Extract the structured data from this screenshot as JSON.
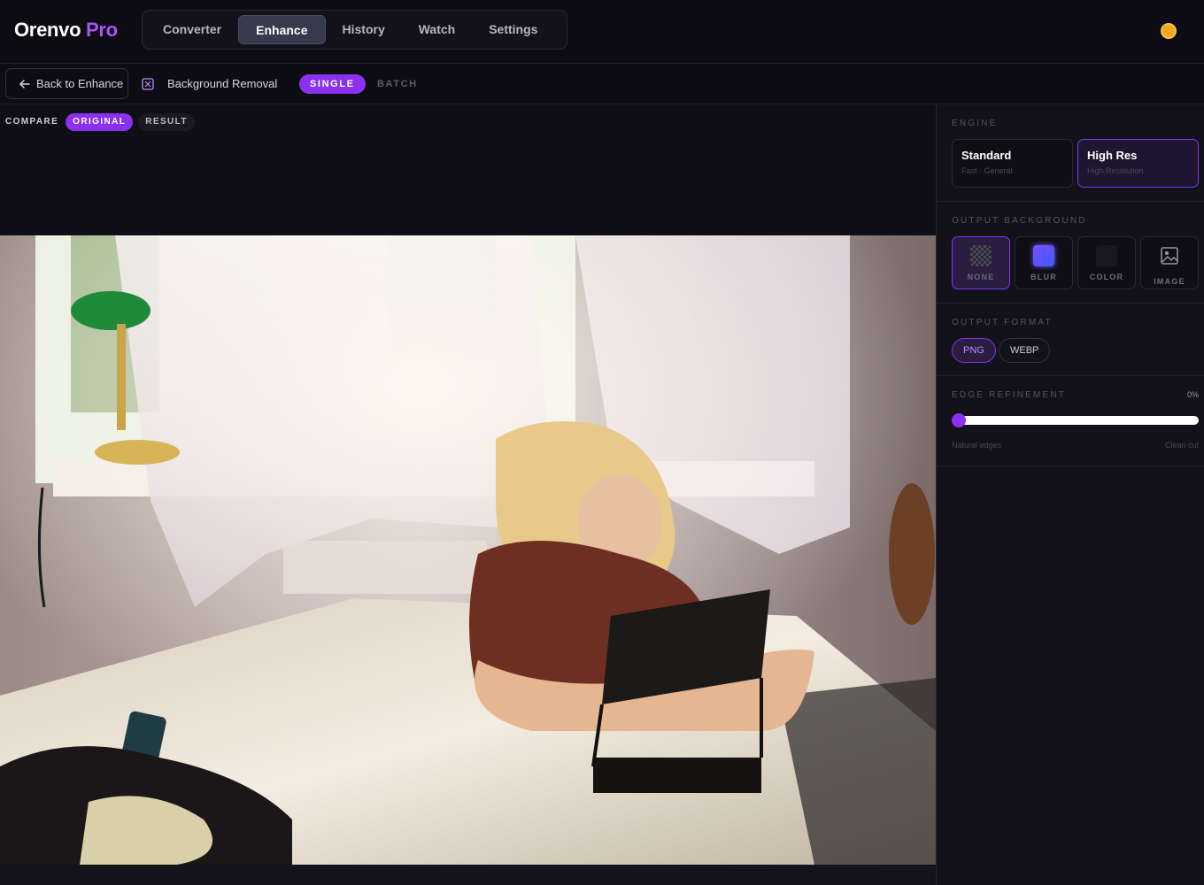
{
  "app": {
    "logo_main": "Orenvo",
    "logo_accent": "Pro",
    "accent_color": "#a855f7",
    "theme_icon": "sun-icon"
  },
  "nav": {
    "items": [
      {
        "label": "Converter"
      },
      {
        "label": "Enhance",
        "active": true
      },
      {
        "label": "History"
      },
      {
        "label": "Watch"
      },
      {
        "label": "Settings"
      }
    ]
  },
  "toolbar": {
    "back_label": "Back to Enhance",
    "back_icon": "arrow-left-icon",
    "tool_icon": "background-removal-icon",
    "tool_label": "Background Removal",
    "mode_single": "SINGLE",
    "mode_batch": "BATCH",
    "active_mode": "SINGLE"
  },
  "preview": {
    "tabs": [
      {
        "label": "COMPARE"
      },
      {
        "label": "ORIGINAL",
        "active": true
      },
      {
        "label": "RESULT"
      }
    ]
  },
  "sidebar": {
    "engine": {
      "title": "ENGINE",
      "options": [
        {
          "name": "Standard",
          "sub": "Fast · General"
        },
        {
          "name": "High Res",
          "sub": "High Resolution",
          "active": true
        }
      ]
    },
    "output_background": {
      "title": "OUTPUT BACKGROUND",
      "options": [
        {
          "label": "NONE",
          "icon": "checkerboard-icon",
          "active": true
        },
        {
          "label": "BLUR",
          "icon": "blur-swatch-icon"
        },
        {
          "label": "COLOR",
          "icon": "color-swatch-icon"
        },
        {
          "label": "IMAGE",
          "icon": "image-icon"
        }
      ]
    },
    "output_format": {
      "title": "OUTPUT FORMAT",
      "options": [
        {
          "label": "PNG",
          "active": true
        },
        {
          "label": "WEBP"
        }
      ]
    },
    "edge_refinement": {
      "title": "EDGE REFINEMENT",
      "value_text": "0%",
      "value": 0,
      "min_label": "Natural edges",
      "max_label": "Clean cut"
    }
  }
}
